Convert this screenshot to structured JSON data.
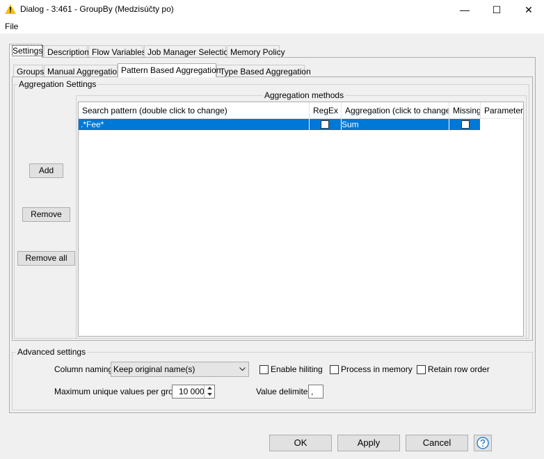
{
  "window": {
    "title": "Dialog - 3:461 - GroupBy (Medzisúčty po)",
    "minimize": "—",
    "maximize": "☐",
    "close": "✕"
  },
  "menu": {
    "file": "File"
  },
  "tabs": [
    "Settings",
    "Description",
    "Flow Variables",
    "Job Manager Selection",
    "Memory Policy"
  ],
  "subtabs": [
    "Groups",
    "Manual Aggregation",
    "Pattern Based Aggregation",
    "Type Based Aggregation"
  ],
  "aggregation_settings": {
    "title": "Aggregation Settings",
    "methods_title": "Aggregation methods",
    "buttons": {
      "add": "Add",
      "remove": "Remove",
      "remove_all": "Remove all"
    },
    "columns": [
      "Search pattern (double click to change)",
      "RegEx",
      "Aggregation (click to change)",
      "Missing",
      "Parameter"
    ],
    "rows": [
      {
        "pattern": ".*Fee*",
        "regex": false,
        "aggregation": "Sum",
        "missing": false,
        "parameter": ""
      }
    ]
  },
  "advanced": {
    "title": "Advanced settings",
    "column_naming_label": "Column naming:",
    "column_naming_value": "Keep original name(s)",
    "enable_hiliting": "Enable hiliting",
    "process_in_memory": "Process in memory",
    "retain_row_order": "Retain row order",
    "max_unique_label": "Maximum unique values per group",
    "max_unique_value": "10 000",
    "value_delimiter_label": "Value delimiter",
    "value_delimiter_value": ","
  },
  "footer": {
    "ok": "OK",
    "apply": "Apply",
    "cancel": "Cancel"
  },
  "colors": {
    "selection": "#0078d7",
    "warning_icon": "#f5c400"
  }
}
